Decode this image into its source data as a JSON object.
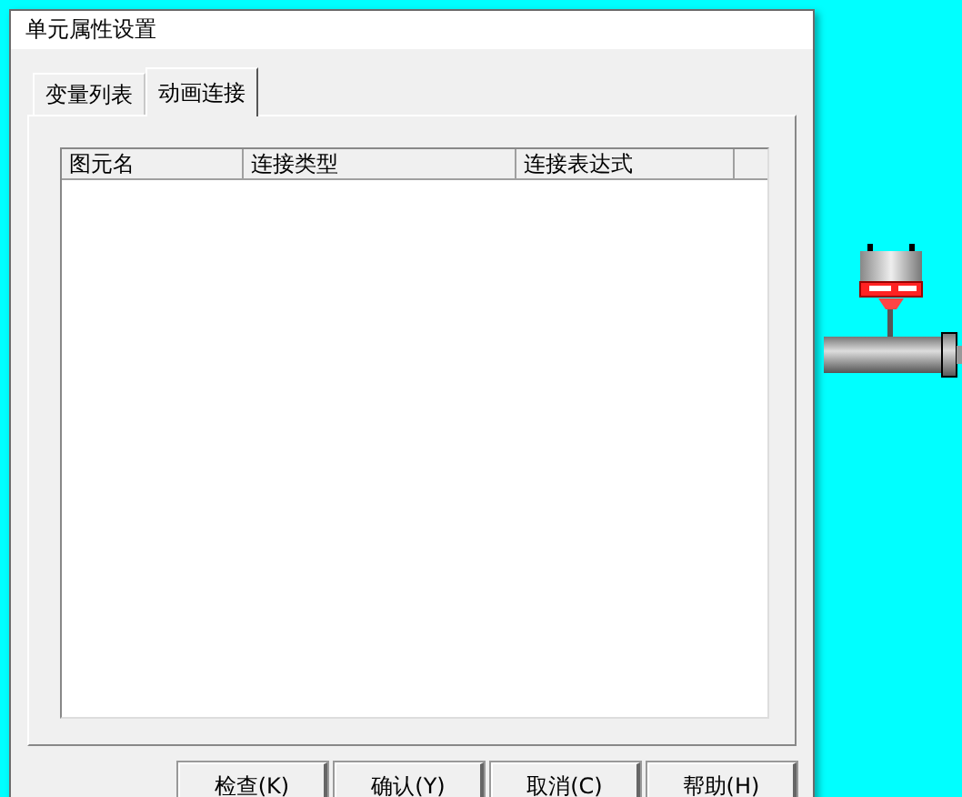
{
  "window": {
    "title": "单元属性设置"
  },
  "tabs": [
    {
      "label": "变量列表",
      "selected": false
    },
    {
      "label": "动画连接",
      "selected": true
    }
  ],
  "table": {
    "columns": [
      "图元名",
      "连接类型",
      "连接表达式"
    ]
  },
  "buttons": [
    "检查(K)",
    "确认(Y)",
    "取消(C)",
    "帮助(H)"
  ]
}
